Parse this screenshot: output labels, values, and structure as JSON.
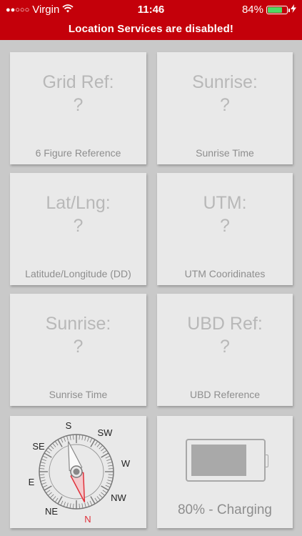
{
  "status_bar": {
    "signal": "●●○○○",
    "carrier": "Virgin",
    "time": "11:46",
    "battery_percent": "84%",
    "battery_level": 0.84,
    "icons": [
      "wifi-icon",
      "battery-icon",
      "charging-bolt-icon"
    ]
  },
  "banner": {
    "text": "Location Services are disabled!"
  },
  "tiles": [
    {
      "title": "Grid Ref:",
      "value": "?",
      "caption": "6 Figure Reference"
    },
    {
      "title": "Sunrise:",
      "value": "?",
      "caption": "Sunrise Time"
    },
    {
      "title": "Lat/Lng:",
      "value": "?",
      "caption": "Latitude/Longitude (DD)"
    },
    {
      "title": "UTM:",
      "value": "?",
      "caption": "UTM Cooridinates"
    },
    {
      "title": "Sunrise:",
      "value": "?",
      "caption": "Sunrise Time"
    },
    {
      "title": "UBD Ref:",
      "value": "?",
      "caption": "UBD Reference"
    }
  ],
  "compass": {
    "labels": {
      "S": "S",
      "SW": "SW",
      "W": "W",
      "NW": "NW",
      "N": "N",
      "NE": "NE",
      "E": "E",
      "SE": "SE"
    },
    "north_color": "#e0303a"
  },
  "battery_tile": {
    "caption": "80% - Charging",
    "level": 0.8
  },
  "colors": {
    "brand_red": "#c4000a",
    "tile_bg": "#e9e9e9",
    "page_bg": "#c9c9c9"
  }
}
